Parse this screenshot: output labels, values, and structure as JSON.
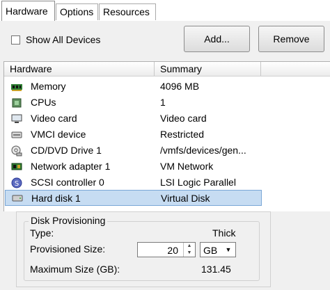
{
  "tabs": [
    {
      "label": "Hardware",
      "active": true
    },
    {
      "label": "Options",
      "active": false
    },
    {
      "label": "Resources",
      "active": false
    }
  ],
  "toolbar": {
    "show_all_label": "Show All Devices",
    "show_all_checked": false,
    "add_label": "Add...",
    "remove_label": "Remove"
  },
  "table": {
    "headers": [
      "Hardware",
      "Summary"
    ],
    "rows": [
      {
        "name": "Memory",
        "summary": "4096 MB",
        "icon": "memory-icon"
      },
      {
        "name": "CPUs",
        "summary": "1",
        "icon": "cpu-icon"
      },
      {
        "name": "Video card",
        "summary": "Video card",
        "icon": "video-card-icon"
      },
      {
        "name": "VMCI device",
        "summary": "Restricted",
        "icon": "vmci-device-icon"
      },
      {
        "name": "CD/DVD Drive 1",
        "summary": "/vmfs/devices/gen...",
        "icon": "cd-dvd-icon"
      },
      {
        "name": "Network adapter 1",
        "summary": "VM Network",
        "icon": "network-adapter-icon"
      },
      {
        "name": "SCSI controller 0",
        "summary": "LSI Logic Parallel",
        "icon": "scsi-controller-icon"
      },
      {
        "name": "Hard disk 1",
        "summary": "Virtual Disk",
        "icon": "hard-disk-icon",
        "selected": true
      }
    ]
  },
  "disk_provisioning": {
    "legend": "Disk Provisioning",
    "type_label": "Type:",
    "type_value": "Thick",
    "provisioned_label": "Provisioned Size:",
    "provisioned_value": "20",
    "unit": "GB",
    "max_label": "Maximum Size (GB):",
    "max_value": "131.45"
  },
  "colors": {
    "selection": "#c6dcf2",
    "panel": "#f0f0f0"
  }
}
